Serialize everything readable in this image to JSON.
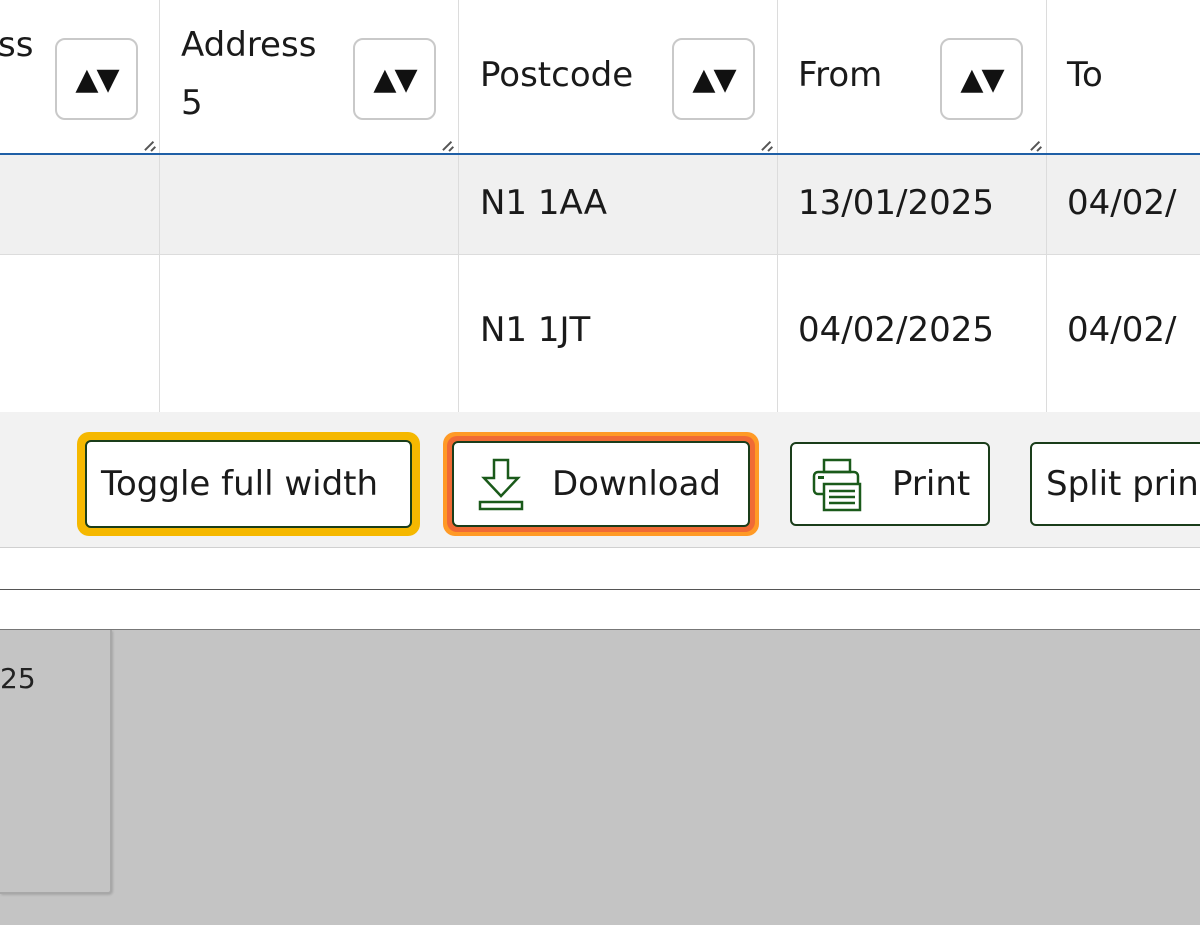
{
  "table": {
    "columns": [
      {
        "label": "ss"
      },
      {
        "label": "Address",
        "label2": "5"
      },
      {
        "label": "Postcode"
      },
      {
        "label": "From"
      },
      {
        "label": "To"
      }
    ],
    "sort_glyph": "▲▼",
    "rows": [
      {
        "postcode": "N1 1AA",
        "from": "13/01/2025",
        "to": "04/02/"
      },
      {
        "postcode": "N1 1JT",
        "from": "04/02/2025",
        "to": "04/02/"
      }
    ]
  },
  "toolbar": {
    "toggle_label": "Toggle full width",
    "download_label": "Download",
    "print_label": "Print",
    "split_print_label": "Split prin"
  },
  "lower_panel": {
    "partial_text": "25"
  },
  "colors": {
    "header_divider": "#1f5fa6",
    "button_border": "#1a3d1a",
    "focus_yellow": "#f5b800",
    "focus_orange": "#f06a35",
    "overlay_gray": "#c4c4c4"
  },
  "icons": {
    "sort": "sort-icon",
    "download": "download-icon",
    "print": "printer-icon"
  }
}
